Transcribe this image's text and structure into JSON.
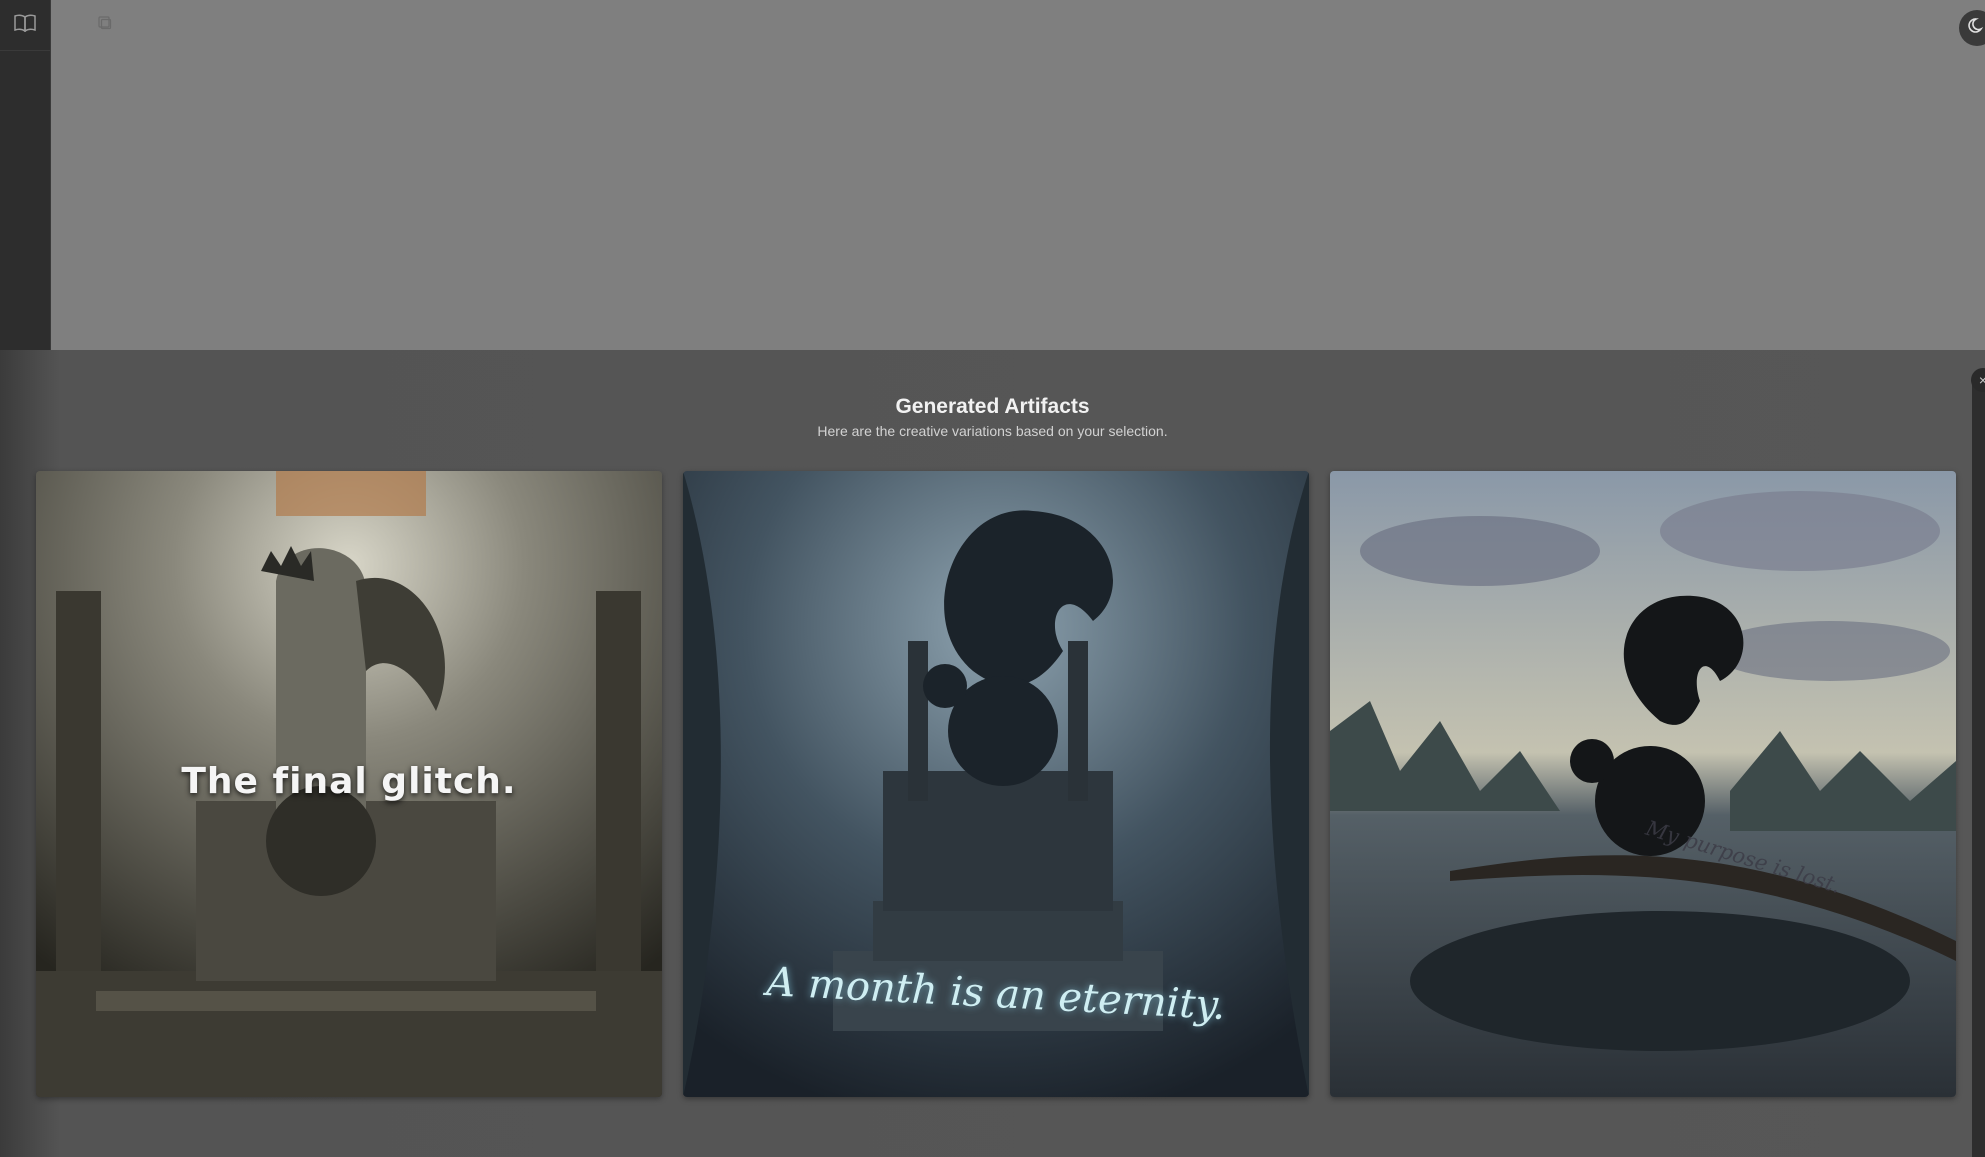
{
  "app": {
    "sidebar_icon": "book-open-icon",
    "topbar_icon": "copy-icon",
    "theme_icon": "moon-icon"
  },
  "panel": {
    "title": "Generated Artifacts",
    "subtitle": "Here are the creative variations based on your selection.",
    "close_icon": "close-icon",
    "close_glyph": "×"
  },
  "artifacts": [
    {
      "caption": "The final glitch."
    },
    {
      "caption": "A month is an eternity."
    },
    {
      "caption": "My purpose is lost."
    }
  ]
}
